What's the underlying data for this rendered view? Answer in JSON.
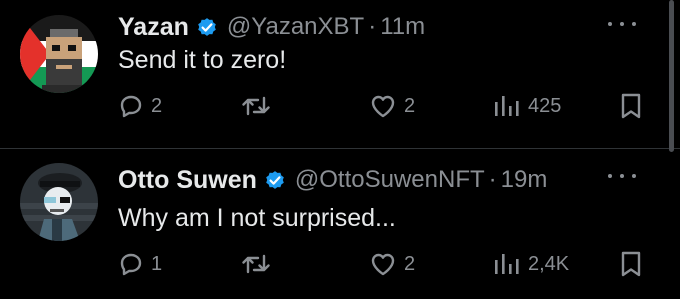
{
  "tweets": [
    {
      "author": "Yazan",
      "handle": "@YazanXBT",
      "separator": "·",
      "time": "11m",
      "text": "Send it to zero!",
      "replies": "2",
      "retweets": "",
      "likes": "2",
      "views": "425",
      "verified": true,
      "avatar_icon": "pixel-art-avatar-flag"
    },
    {
      "author": "Otto Suwen",
      "handle": "@OttoSuwenNFT",
      "separator": "·",
      "time": "19m",
      "text": "Why am I not surprised...",
      "replies": "1",
      "retweets": "",
      "likes": "2",
      "views": "2,4K",
      "verified": true,
      "avatar_icon": "cartoon-character-avatar"
    }
  ],
  "icons": {
    "reply": "reply-icon",
    "retweet": "retweet-icon",
    "like": "heart-icon",
    "views": "views-chart-icon",
    "bookmark": "bookmark-icon",
    "more": "more-icon",
    "verified": "verified-badge-icon"
  },
  "colors": {
    "background": "#000000",
    "primary_text": "#e7e9ea",
    "secondary_text": "#8b8f94",
    "verified_blue": "#1d9bf0",
    "divider": "#2f3336"
  }
}
